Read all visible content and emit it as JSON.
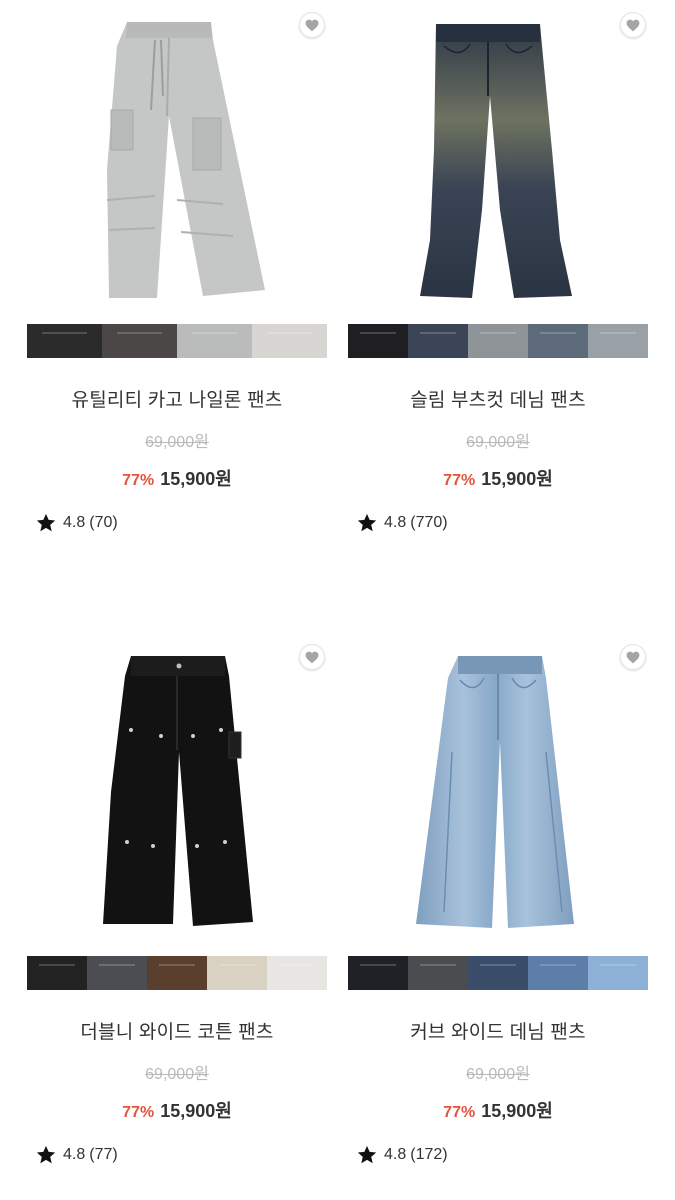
{
  "products": [
    {
      "name": "유틸리티 카고 나일론 팬츠",
      "original_price": "69,000원",
      "discount": "77%",
      "sale_price": "15,900원",
      "rating": "4.8",
      "review_count": "(70)",
      "image_icon": "cargo-pants-image",
      "main_color": "#c4c7c6",
      "swatches": [
        "#2b2b2c",
        "#4a4746",
        "#b9bcbb",
        "#d7d6d3"
      ]
    },
    {
      "name": "슬림 부츠컷 데님 팬츠",
      "original_price": "69,000원",
      "discount": "77%",
      "sale_price": "15,900원",
      "rating": "4.8",
      "review_count": "(770)",
      "image_icon": "bootcut-jeans-image",
      "main_color": "#2e3848",
      "swatches": [
        "#1f1f22",
        "#3b4456",
        "#8f9498",
        "#5d6a7a",
        "#9aa1a6"
      ]
    },
    {
      "name": "더블니 와이드 코튼 팬츠",
      "original_price": "69,000원",
      "discount": "77%",
      "sale_price": "15,900원",
      "rating": "4.8",
      "review_count": "(77)",
      "image_icon": "double-knee-pants-image",
      "main_color": "#121212",
      "swatches": [
        "#222222",
        "#4b4d52",
        "#5a3f2e",
        "#d9d2c2",
        "#e7e6e3"
      ]
    },
    {
      "name": "커브 와이드 데님 팬츠",
      "original_price": "69,000원",
      "discount": "77%",
      "sale_price": "15,900원",
      "rating": "4.8",
      "review_count": "(172)",
      "image_icon": "wide-jeans-image",
      "main_color": "#8fb0cf",
      "swatches": [
        "#1e2125",
        "#4a4c50",
        "#3a4d6b",
        "#5c7ea8",
        "#8db0d6"
      ]
    }
  ],
  "icons": {
    "wish": "heart-icon",
    "rating": "star-icon"
  }
}
